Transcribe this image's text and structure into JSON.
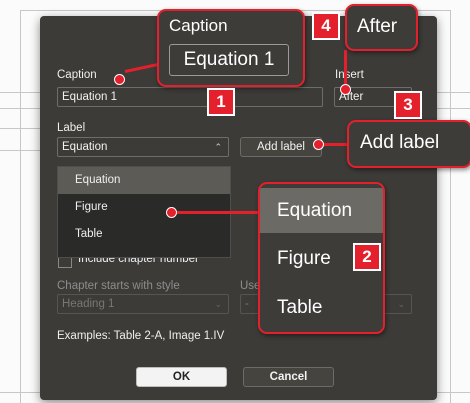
{
  "dialog": {
    "caption_label": "Caption",
    "caption_value": "Equation 1",
    "insert_label": "Insert",
    "insert_value": "After",
    "label_label": "Label",
    "label_value": "Equation",
    "add_label_button": "Add label",
    "dropdown_items": [
      "Equation",
      "Figure",
      "Table"
    ],
    "dropdown_selected": "Equation",
    "include_chapter": "Include chapter number",
    "chapter_style_label": "Chapter starts with style",
    "chapter_style_value": "Heading 1",
    "separator_label": "Use",
    "separator_value": "-",
    "examples": "Examples: Table 2-A, Image 1.IV",
    "ok_button": "OK",
    "cancel_button": "Cancel"
  },
  "callouts": {
    "caption_title": "Caption",
    "caption_value": "Equation 1",
    "after_value": "After",
    "add_label": "Add label",
    "list_items": [
      "Equation",
      "Figure",
      "Table"
    ]
  },
  "badges": {
    "one": "1",
    "two": "2",
    "three": "3",
    "four": "4"
  },
  "colors": {
    "accent_red": "#e3202b",
    "dialog_bg": "#3c3b38"
  }
}
